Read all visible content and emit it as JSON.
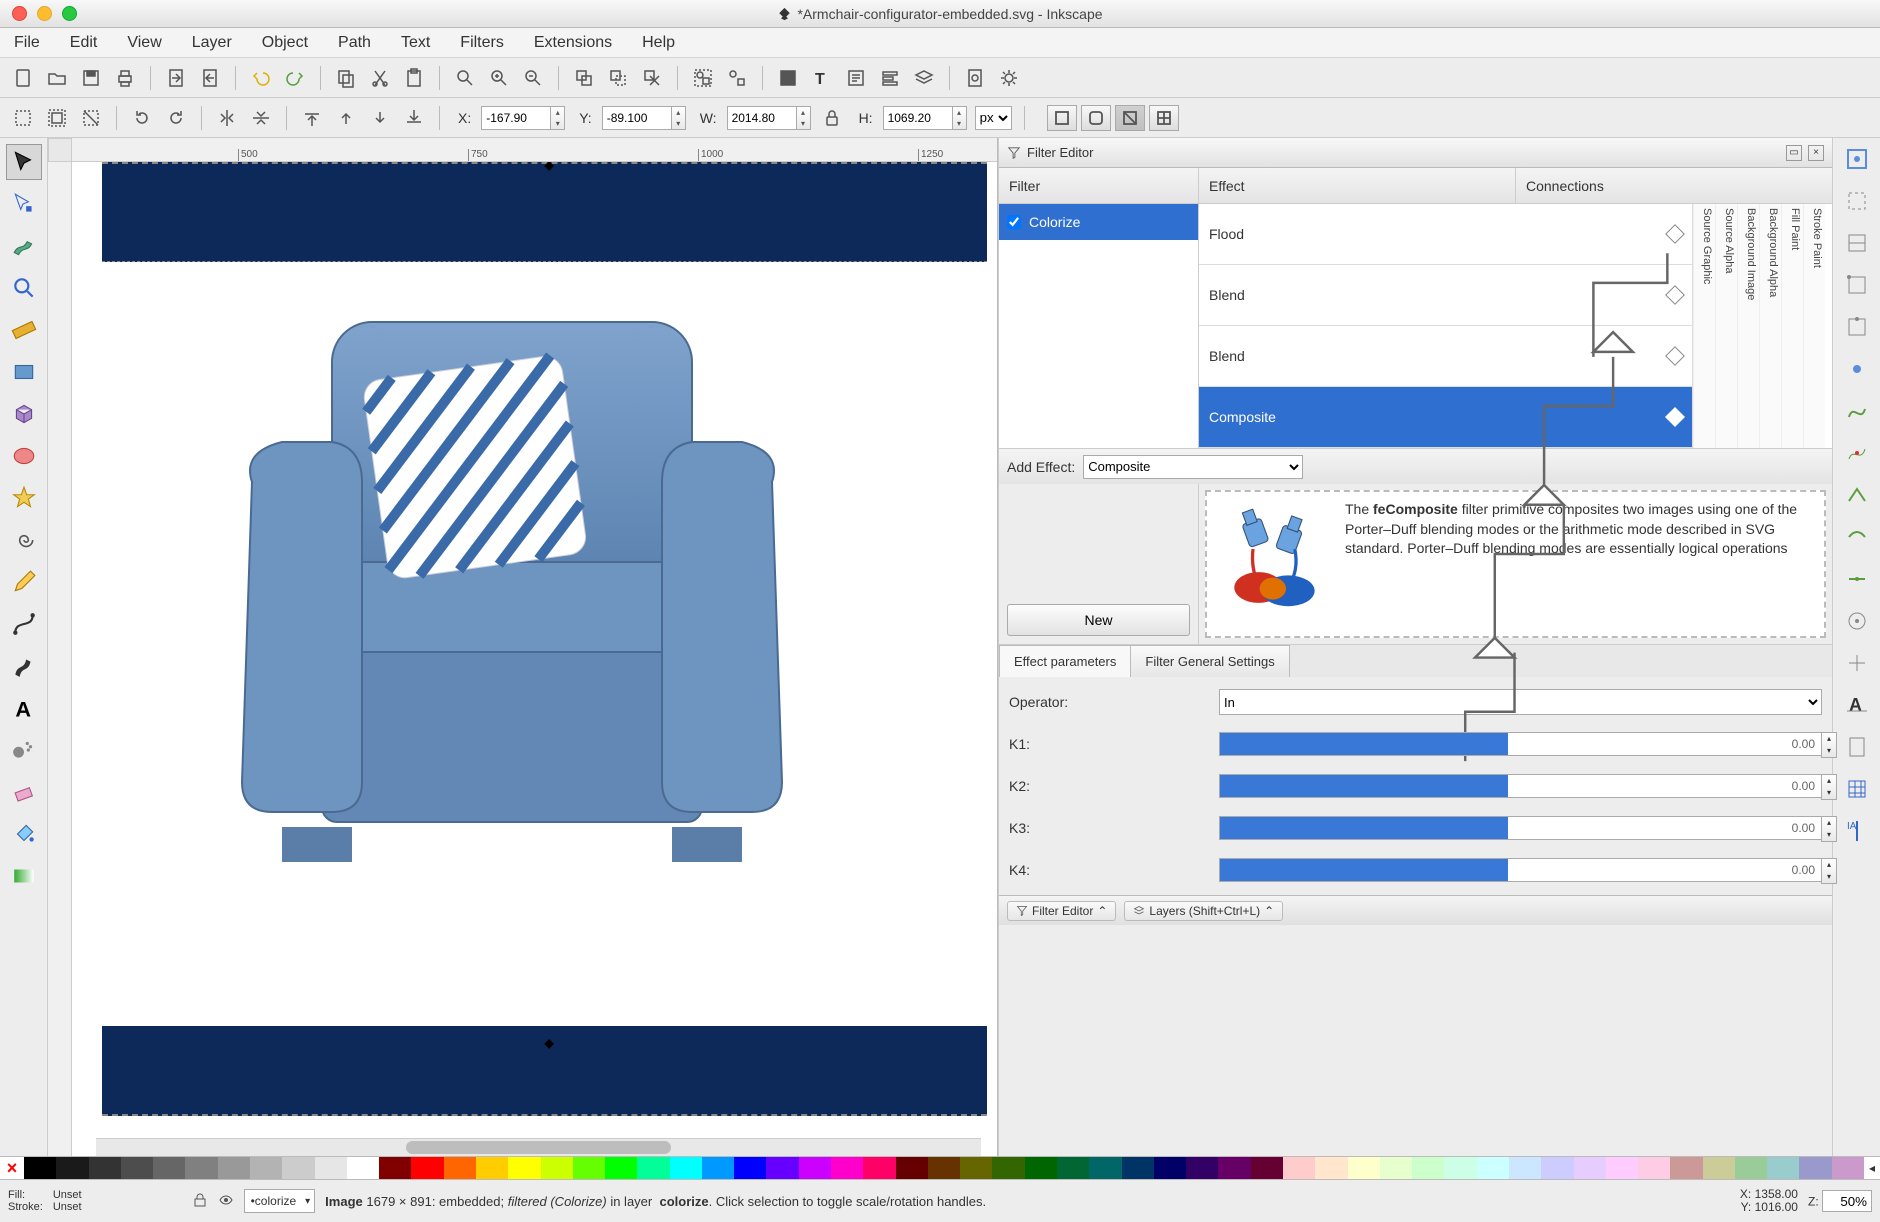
{
  "window": {
    "title": "*Armchair-configurator-embedded.svg - Inkscape",
    "icon": "inkscape-icon"
  },
  "menubar": [
    "File",
    "Edit",
    "View",
    "Layer",
    "Object",
    "Path",
    "Text",
    "Filters",
    "Extensions",
    "Help"
  ],
  "controlbar": {
    "x_label": "X:",
    "x": "-167.90",
    "y_label": "Y:",
    "y": "-89.100",
    "w_label": "W:",
    "w": "2014.80",
    "h_label": "H:",
    "h": "1069.20",
    "unit": "px"
  },
  "ruler_ticks": [
    {
      "pos": 190,
      "label": "500"
    },
    {
      "pos": 420,
      "label": "750"
    },
    {
      "pos": 650,
      "label": "1000"
    },
    {
      "pos": 870,
      "label": "1250"
    }
  ],
  "filter_editor": {
    "title": "Filter Editor",
    "col_filter": "Filter",
    "col_effect": "Effect",
    "col_connections": "Connections",
    "filters": [
      {
        "name": "Colorize",
        "checked": true,
        "selected": true
      }
    ],
    "effects": [
      {
        "name": "Flood",
        "selected": false
      },
      {
        "name": "Blend",
        "selected": false
      },
      {
        "name": "Blend",
        "selected": false
      },
      {
        "name": "Composite",
        "selected": true
      }
    ],
    "io_labels": [
      "Source Graphic",
      "Source Alpha",
      "Background Image",
      "Background Alpha",
      "Fill Paint",
      "Stroke Paint"
    ],
    "add_effect_label": "Add Effect:",
    "add_effect_value": "Composite",
    "new_button": "New",
    "description": "The feComposite filter primitive composites two images using one of the Porter-Duff blending modes or the arithmetic mode described in SVG standard. Porter-Duff blending modes are essentially logical operations",
    "desc_bold": "feComposite",
    "param_tabs": [
      "Effect parameters",
      "Filter General Settings"
    ],
    "operator_label": "Operator:",
    "operator_value": "In",
    "k_params": [
      {
        "label": "K1:",
        "value": "0.00"
      },
      {
        "label": "K2:",
        "value": "0.00"
      },
      {
        "label": "K3:",
        "value": "0.00"
      },
      {
        "label": "K4:",
        "value": "0.00"
      }
    ],
    "bottom_tabs": [
      "Filter Editor",
      "Layers (Shift+Ctrl+L)"
    ]
  },
  "statusbar": {
    "fill_label": "Fill:",
    "stroke_label": "Stroke:",
    "fill_value": "Unset",
    "stroke_value": "Unset",
    "layer": "•colorize",
    "info_prefix": "Image",
    "info_dims": "1679 × 891",
    "info_embedded": ": embedded;",
    "info_filtered": "filtered (Colorize)",
    "info_layer": "in layer",
    "info_layer_name": "colorize",
    "info_hint": ". Click selection to toggle scale/rotation handles.",
    "coord_x_label": "X:",
    "coord_x": "1358.00",
    "coord_y_label": "Y:",
    "coord_y": "1016.00",
    "z_label": "Z:",
    "zoom": "50%"
  },
  "palette_colors": [
    "#000000",
    "#1a1a1a",
    "#333333",
    "#4d4d4d",
    "#666666",
    "#808080",
    "#999999",
    "#b3b3b3",
    "#cccccc",
    "#e6e6e6",
    "#ffffff",
    "#800000",
    "#ff0000",
    "#ff6600",
    "#ffcc00",
    "#ffff00",
    "#ccff00",
    "#66ff00",
    "#00ff00",
    "#00ff99",
    "#00ffff",
    "#0099ff",
    "#0000ff",
    "#6600ff",
    "#cc00ff",
    "#ff00cc",
    "#ff0066",
    "#660000",
    "#663300",
    "#666600",
    "#336600",
    "#006600",
    "#006633",
    "#006666",
    "#003366",
    "#000066",
    "#330066",
    "#660066",
    "#660033",
    "#ffcccc",
    "#ffe6cc",
    "#ffffcc",
    "#e6ffcc",
    "#ccffcc",
    "#ccffe6",
    "#ccffff",
    "#cce6ff",
    "#ccccff",
    "#e6ccff",
    "#ffccff",
    "#ffcce6",
    "#cc9999",
    "#cccc99",
    "#99cc99",
    "#99cccc",
    "#9999cc",
    "#cc99cc"
  ]
}
